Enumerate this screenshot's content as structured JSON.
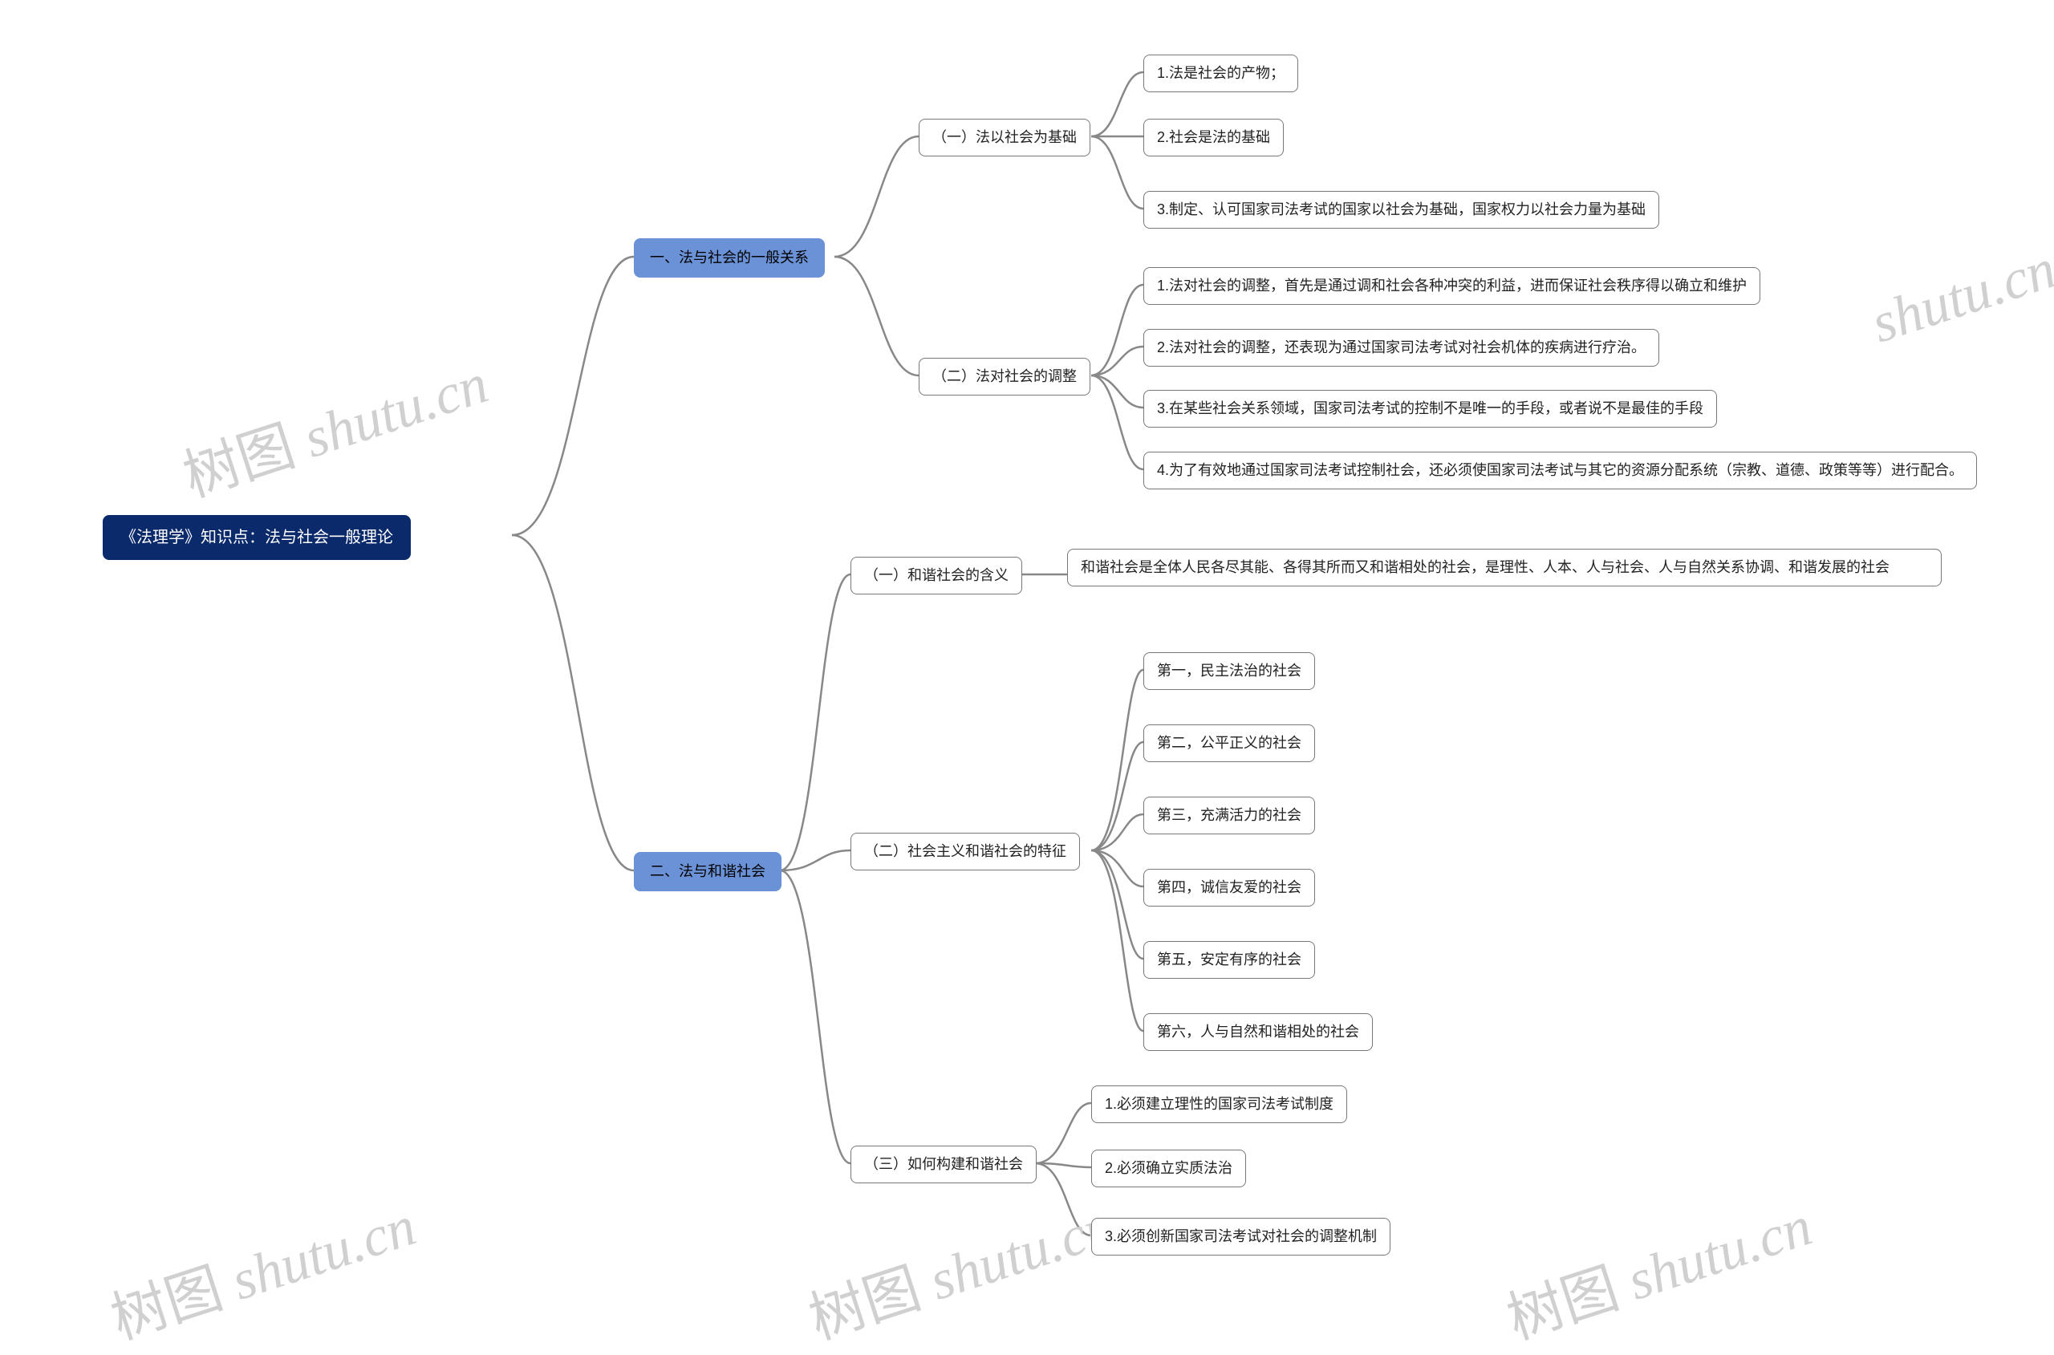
{
  "root": "《法理学》知识点：法与社会一般理论",
  "branch1": "一、法与社会的一般关系",
  "branch2": "二、法与和谐社会",
  "n1_1": "（一）法以社会为基础",
  "n1_2": "（二）法对社会的调整",
  "n1_1_1": "1.法是社会的产物；",
  "n1_1_2": "2.社会是法的基础",
  "n1_1_3": "3.制定、认可国家司法考试的国家以社会为基础，国家权力以社会力量为基础",
  "n1_2_1": "1.法对社会的调整，首先是通过调和社会各种冲突的利益，进而保证社会秩序得以确立和维护",
  "n1_2_2": "2.法对社会的调整，还表现为通过国家司法考试对社会机体的疾病进行疗治。",
  "n1_2_3": "3.在某些社会关系领域，国家司法考试的控制不是唯一的手段，或者说不是最佳的手段",
  "n1_2_4": "4.为了有效地通过国家司法考试控制社会，还必须使国家司法考试与其它的资源分配系统（宗教、道德、政策等等）进行配合。",
  "n2_1": "（一）和谐社会的含义",
  "n2_2": "（二）社会主义和谐社会的特征",
  "n2_3": "（三）如何构建和谐社会",
  "n2_1_1": "和谐社会是全体人民各尽其能、各得其所而又和谐相处的社会，是理性、人本、人与社会、人与自然关系协调、和谐发展的社会",
  "n2_2_1": "第一，民主法治的社会",
  "n2_2_2": "第二，公平正义的社会",
  "n2_2_3": "第三，充满活力的社会",
  "n2_2_4": "第四，诚信友爱的社会",
  "n2_2_5": "第五，安定有序的社会",
  "n2_2_6": "第六，人与自然和谐相处的社会",
  "n2_3_1": "1.必须建立理性的国家司法考试制度",
  "n2_3_2": "2.必须确立实质法治",
  "n2_3_3": "3.必须创新国家司法考试对社会的调整机制",
  "watermark": "shutu.cn",
  "watermark_prefix": "树图",
  "colors": {
    "root_bg": "#0b2a6b",
    "branch_bg": "#6b92d6",
    "leaf_border": "#777777"
  }
}
